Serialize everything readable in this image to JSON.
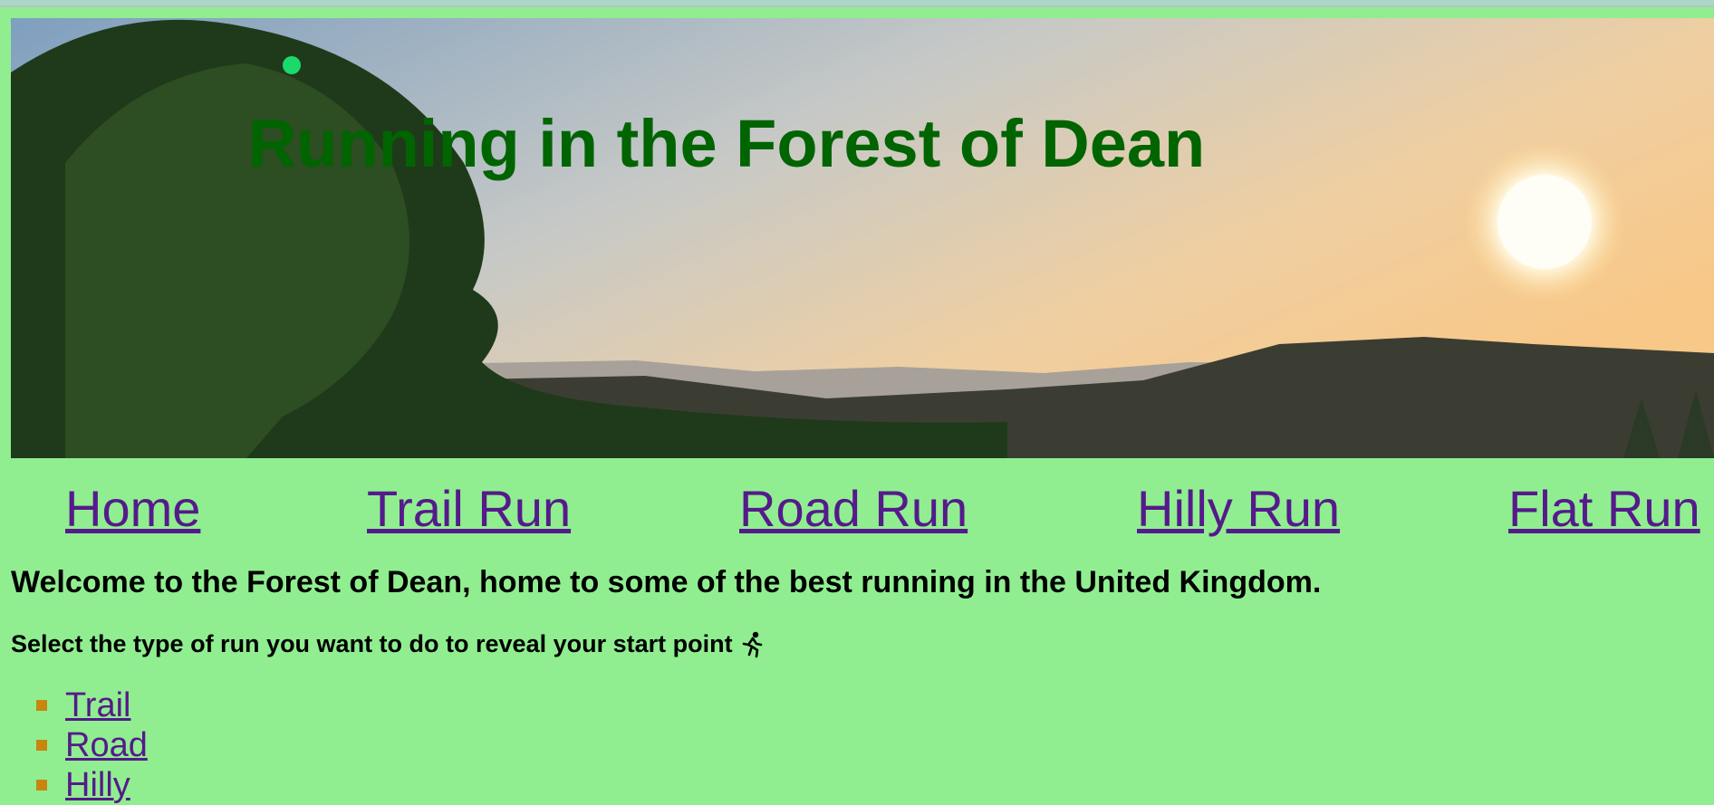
{
  "hero": {
    "title": "Running in the Forest of Dean",
    "title_color": "#006400",
    "image_description_icon": "sunset-landscape-image"
  },
  "nav": {
    "items": [
      {
        "label": "Home"
      },
      {
        "label": "Trail Run"
      },
      {
        "label": "Road Run"
      },
      {
        "label": "Hilly Run"
      },
      {
        "label": "Flat Run"
      }
    ],
    "link_color": "#551a8b"
  },
  "content": {
    "welcome": "Welcome to the Forest of Dean, home to some of the best running in the United Kingdom.",
    "select_prompt": "Select the type of run you want to do to reveal your start point",
    "runner_icon": "runner-icon",
    "run_types": [
      {
        "label": "Trail"
      },
      {
        "label": "Road"
      },
      {
        "label": "Hilly"
      }
    ],
    "bullet_color": "#c8860e"
  },
  "page": {
    "background": "#90ee90"
  }
}
